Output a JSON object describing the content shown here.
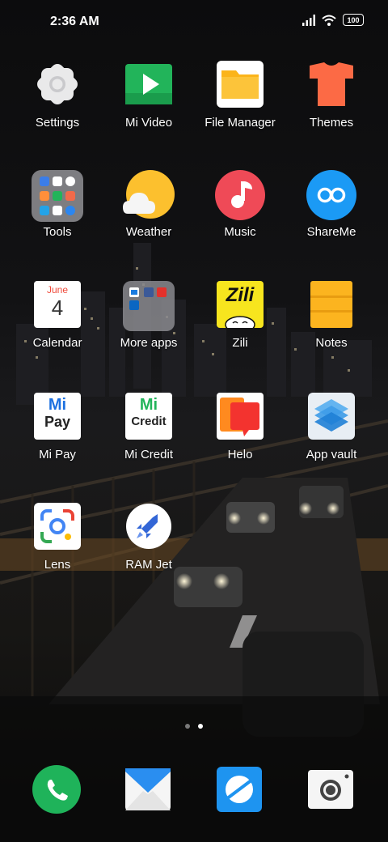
{
  "status_bar": {
    "time": "2:36 AM",
    "battery": "100"
  },
  "apps": {
    "settings": "Settings",
    "mi_video": "Mi Video",
    "file_manager": "File Manager",
    "themes": "Themes",
    "tools": "Tools",
    "weather": "Weather",
    "music": "Music",
    "shareme": "ShareMe",
    "calendar": "Calendar",
    "more_apps": "More apps",
    "zili": "Zili",
    "notes": "Notes",
    "mi_pay": "Mi Pay",
    "mi_credit": "Mi Credit",
    "helo": "Helo",
    "app_vault": "App vault",
    "lens": "Lens",
    "ram_jet": "RAM Jet"
  },
  "icon_text": {
    "calendar_month": "June",
    "calendar_day": "4",
    "zili": "Zili",
    "mipay_top": "Mi",
    "mipay_bottom": "Pay",
    "micredit_top": "Mi",
    "micredit_bottom": "Credit"
  },
  "page_indicator": {
    "count": 2,
    "active": 2
  },
  "dock": [
    "phone-icon",
    "messages-icon",
    "browser-icon",
    "camera-icon"
  ],
  "colors": {
    "mi_video": "#22b45a",
    "file_manager": "#fbb41a",
    "themes": "#fc6a45",
    "music": "#ef4a57",
    "shareme": "#1b9af5",
    "notes": "#fcb41f",
    "phone": "#1fb35a",
    "browser": "#1e94f0"
  }
}
